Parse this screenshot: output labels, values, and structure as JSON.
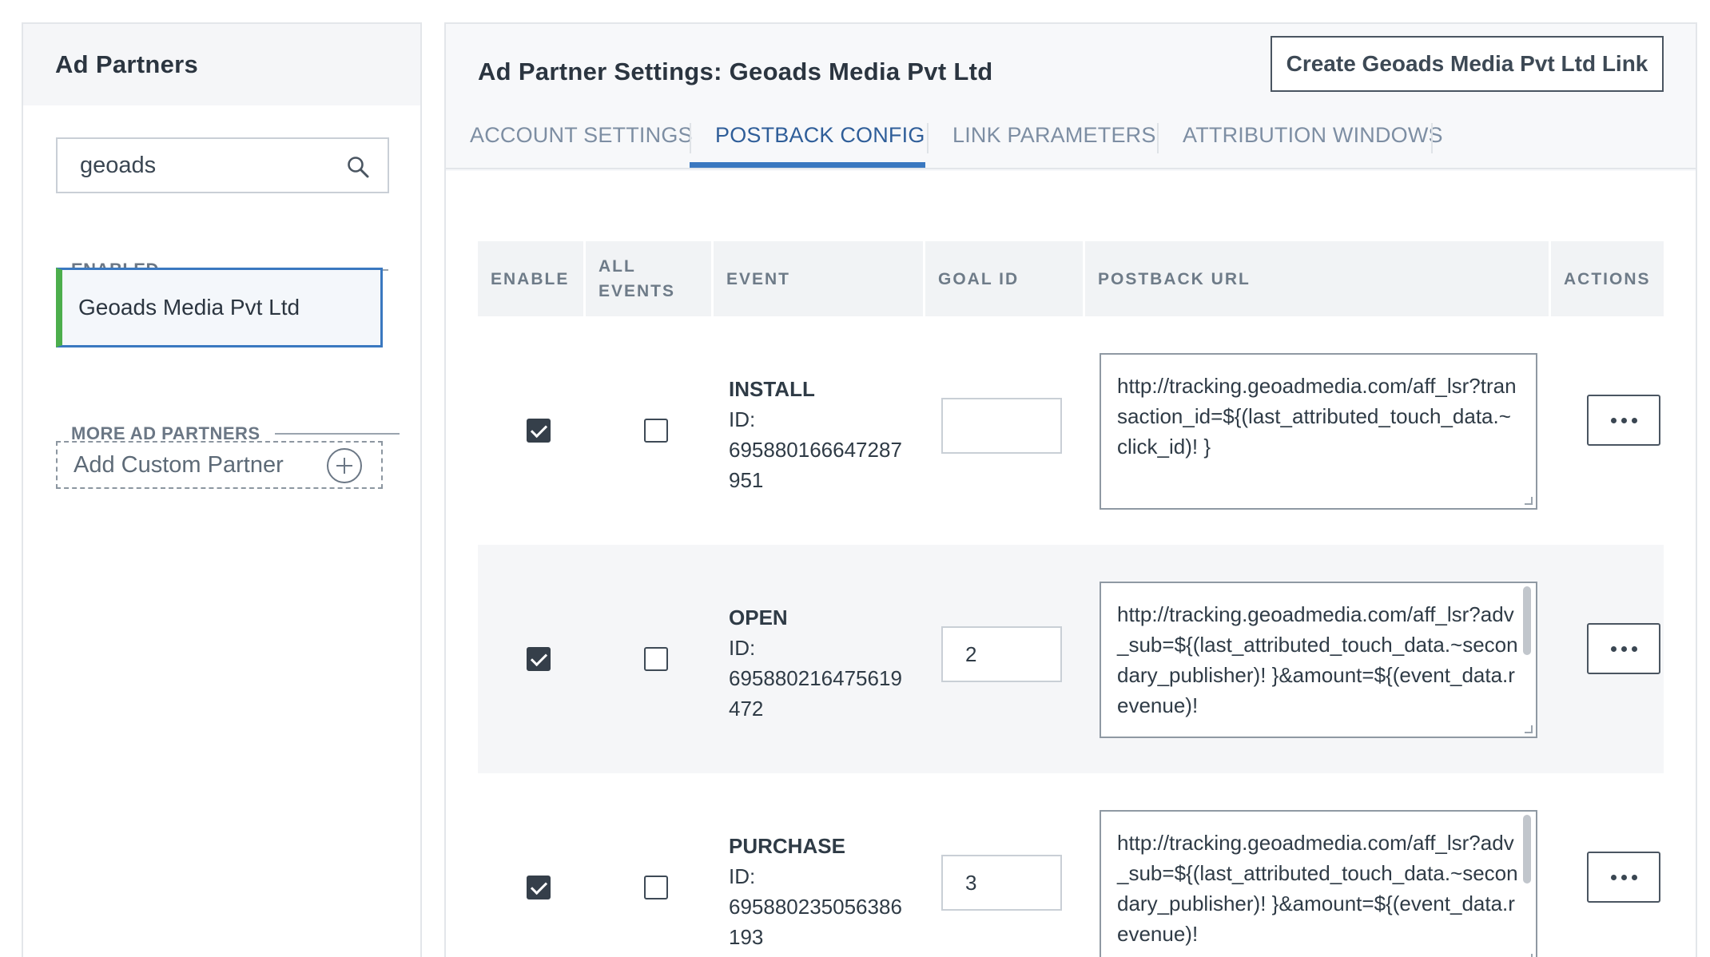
{
  "sidebar": {
    "title": "Ad Partners",
    "search": {
      "value": "geoads"
    },
    "enabled_label": "ENABLED",
    "enabled_partners": [
      "Geoads Media Pvt Ltd"
    ],
    "more_label": "MORE AD PARTNERS",
    "add_custom_label": "Add Custom Partner"
  },
  "main": {
    "title": "Ad Partner Settings: Geoads Media Pvt Ltd",
    "create_button": "Create Geoads Media Pvt Ltd Link",
    "tabs": [
      {
        "label": "ACCOUNT SETTINGS"
      },
      {
        "label": "POSTBACK CONFIG",
        "active": true
      },
      {
        "label": "LINK PARAMETERS"
      },
      {
        "label": "ATTRIBUTION WINDOWS"
      }
    ],
    "table": {
      "headers": {
        "enable": "ENABLE",
        "all_events_1": "ALL",
        "all_events_2": "EVENTS",
        "event": "EVENT",
        "goal_id": "GOAL ID",
        "postback_url": "POSTBACK URL",
        "actions": "ACTIONS"
      },
      "rows": [
        {
          "enabled": true,
          "all_events": false,
          "event_name": "INSTALL",
          "id_label": "ID:",
          "id_line1": "695880166647287",
          "id_line2": "951",
          "goal_id": "",
          "postback_url": "http://tracking.geoadmedia.com/aff_lsr?transaction_id=${(last_attributed_touch_data.~click_id)! }"
        },
        {
          "enabled": true,
          "all_events": false,
          "event_name": "OPEN",
          "id_label": "ID:",
          "id_line1": "695880216475619",
          "id_line2": "472",
          "goal_id": "2",
          "postback_url": "http://tracking.geoadmedia.com/aff_lsr?adv_sub=${(last_attributed_touch_data.~secondary_publisher)! }&amount=${(event_data.revenue)!"
        },
        {
          "enabled": true,
          "all_events": false,
          "event_name": "PURCHASE",
          "id_label": "ID:",
          "id_line1": "695880235056386",
          "id_line2": "193",
          "goal_id": "3",
          "postback_url": "http://tracking.geoadmedia.com/aff_lsr?adv_sub=${(last_attributed_touch_data.~secondary_publisher)! }&amount=${(event_data.revenue)!"
        }
      ]
    }
  }
}
